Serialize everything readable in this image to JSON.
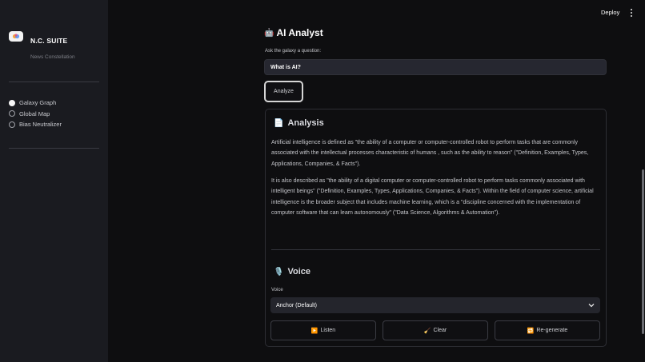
{
  "sidebar": {
    "brand": "N.C. SUITE",
    "tagline": "News Constellation",
    "nav": [
      {
        "label": "Galaxy Graph",
        "selected": true
      },
      {
        "label": "Global Map",
        "selected": false
      },
      {
        "label": "Bias Neutralizer",
        "selected": false
      }
    ]
  },
  "topbar": {
    "deploy_label": "Deploy"
  },
  "main": {
    "title": "AI Analyst",
    "title_icon": "🤖",
    "question_label": "Ask the galaxy a question:",
    "question_value": "What is AI?",
    "analyze_label": "Analyze",
    "analysis": {
      "icon": "📄",
      "heading": "Analysis",
      "paragraphs": [
        "Artificial intelligence is defined as \"the ability of a computer or computer-controlled robot to perform tasks that are commonly associated with the intellectual processes characteristic of humans , such as the ability to reason\" (\"Definition, Examples, Types, Applications, Companies, & Facts\").",
        "It is also described as \"the ability of a digital computer or computer-controlled robot to perform tasks commonly associated with intelligent beings\" (\"Definition, Examples, Types, Applications, Companies, & Facts\"). Within the field of computer science, artificial intelligence is the broader subject that includes machine learning, which is a \"discipline concerned with the implementation of computer software that can learn autonomously\" (\"Data Science, Algorithms & Automation\")."
      ]
    },
    "voice": {
      "icon": "🎙️",
      "heading": "Voice",
      "label": "Voice",
      "selected": "Anchor (Default)",
      "buttons": [
        {
          "icon": "▶️",
          "label": "Listen"
        },
        {
          "icon": "🧹",
          "label": "Clear"
        },
        {
          "icon": "🔁",
          "label": "Re-generate"
        }
      ]
    }
  },
  "colors": {
    "background": "#0e0e10",
    "sidebar": "#1a1b20",
    "input": "#262730"
  }
}
